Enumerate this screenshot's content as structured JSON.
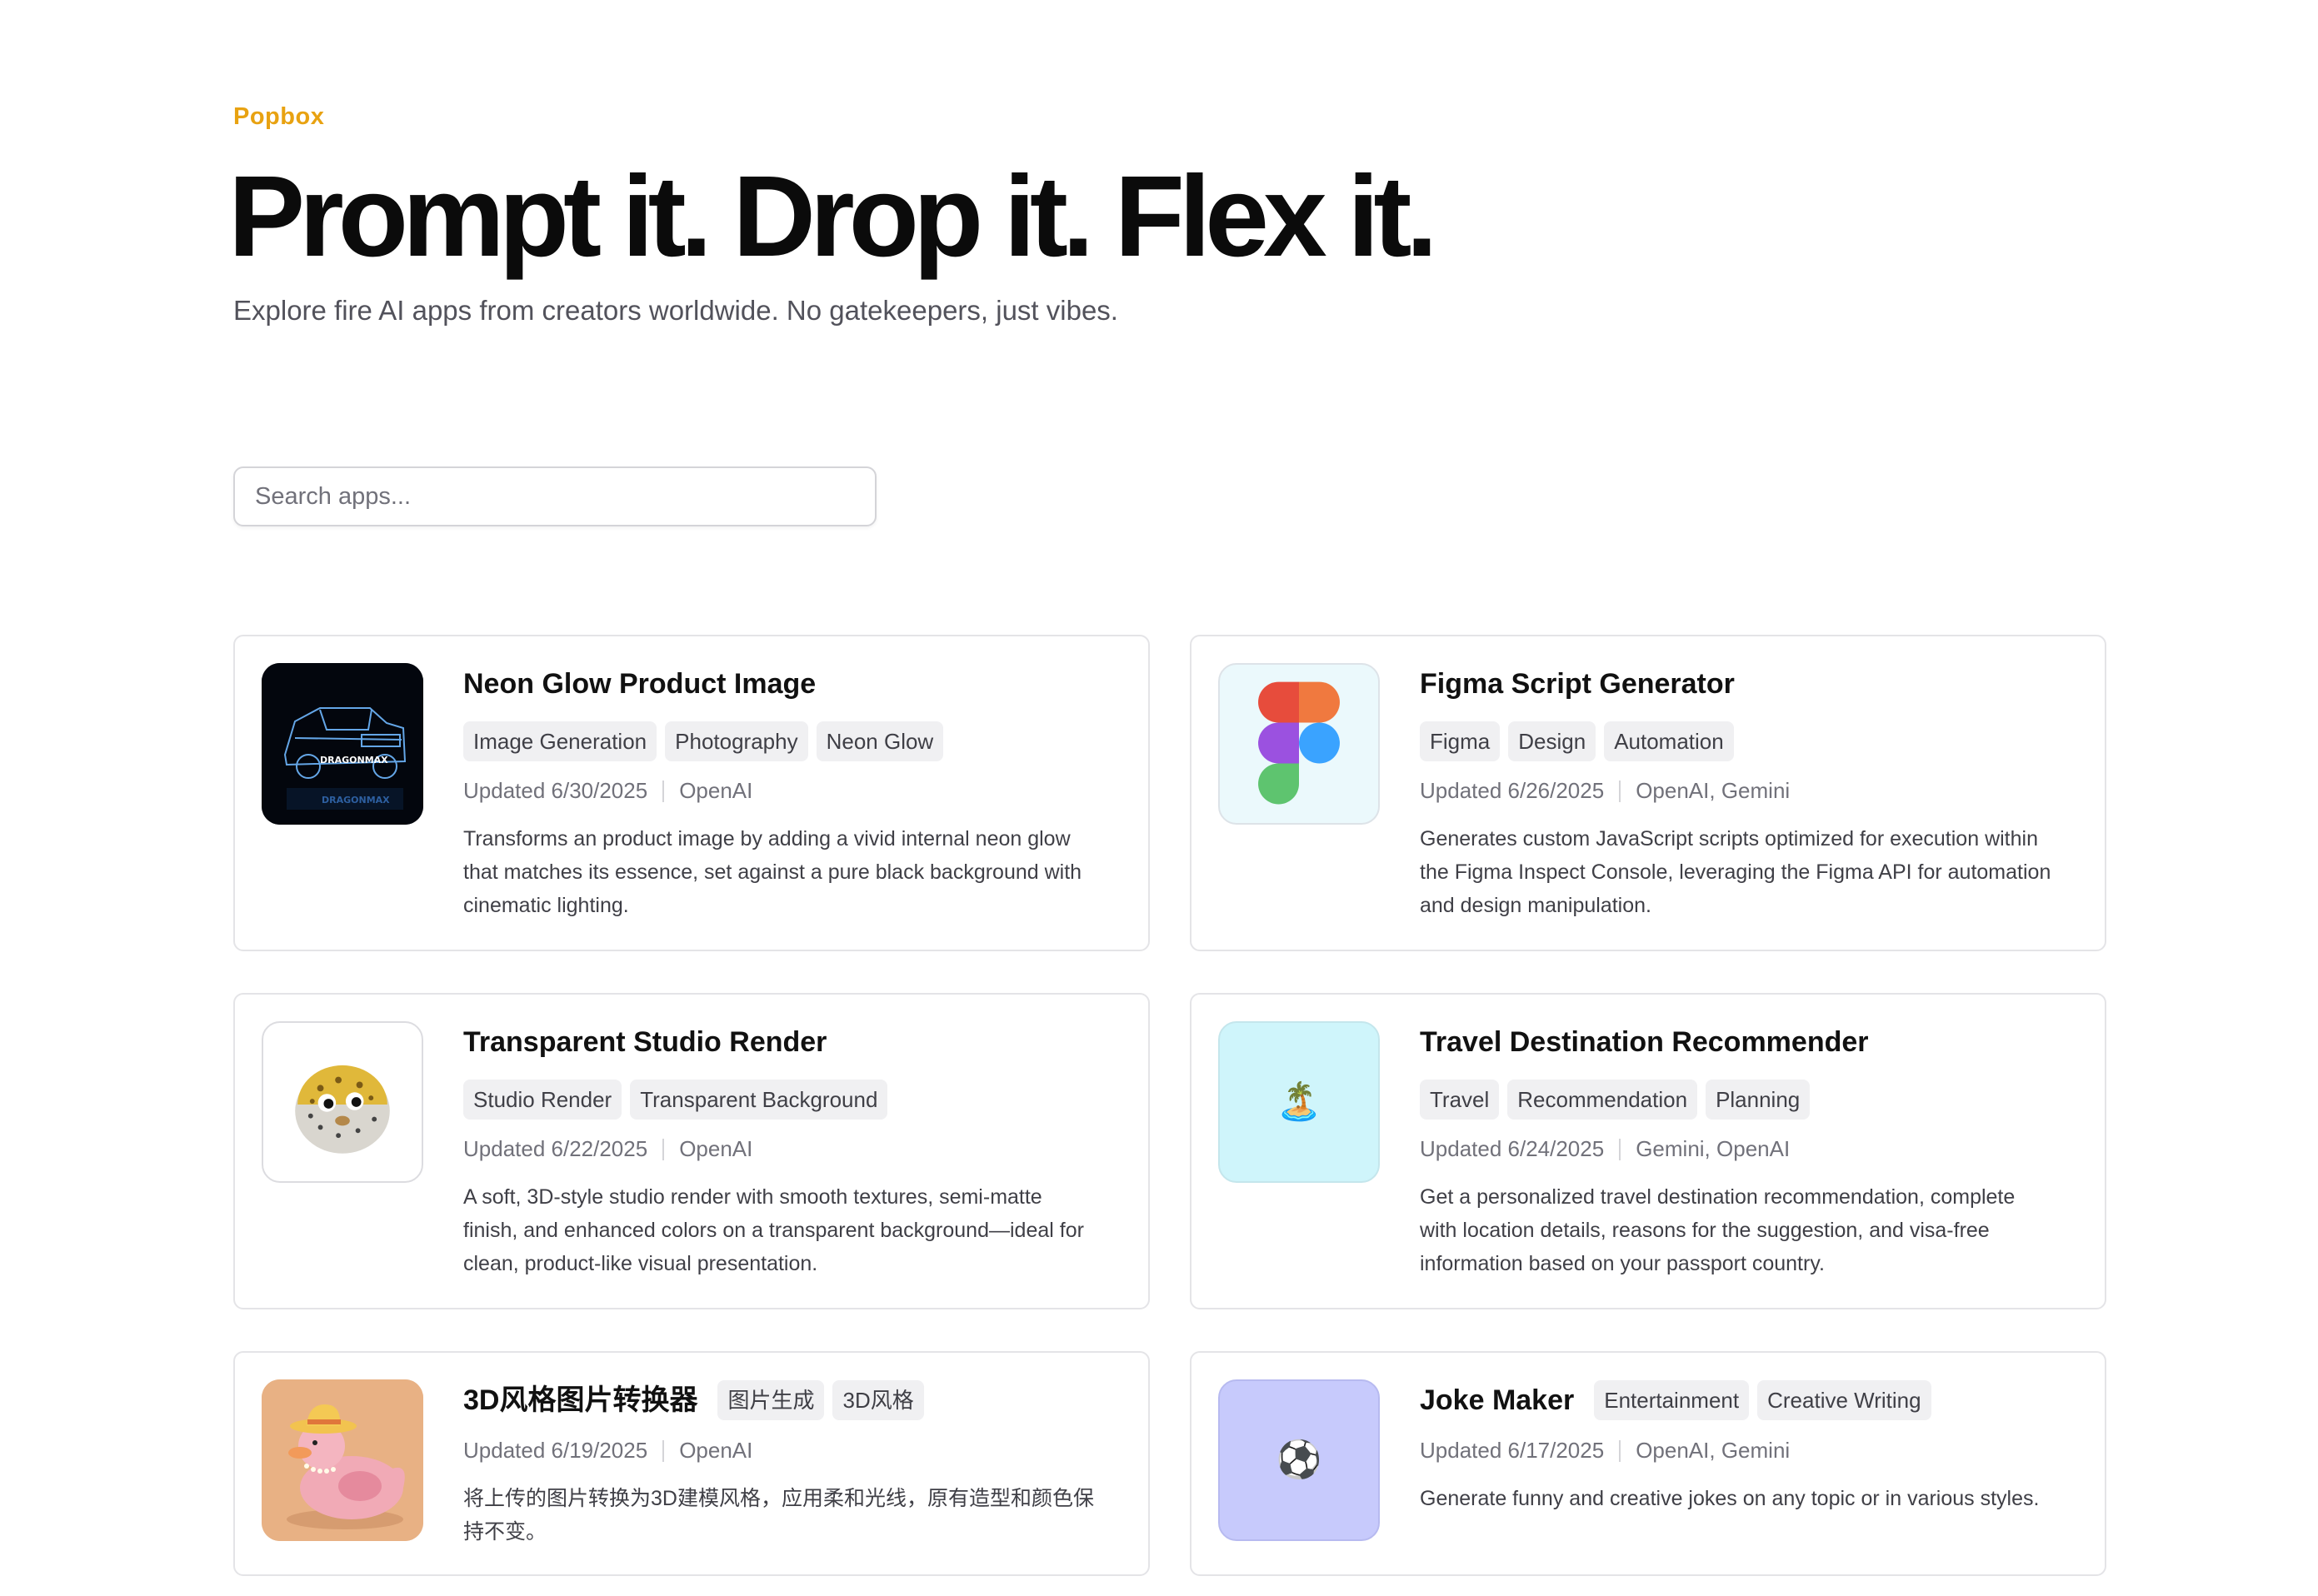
{
  "header": {
    "brand": "Popbox",
    "headline": "Prompt it. Drop it. Flex it.",
    "subheadline": "Explore fire AI apps from creators worldwide. No gatekeepers, just vibes."
  },
  "search": {
    "placeholder": "Search apps..."
  },
  "apps": [
    {
      "title": "Neon Glow Product Image",
      "tags": [
        "Image Generation",
        "Photography",
        "Neon Glow"
      ],
      "updated": "Updated 6/30/2025",
      "models": "OpenAI",
      "description": "Transforms an product image by adding a vivid internal neon glow that matches its essence, set against a pure black background with cinematic lighting.",
      "icon": "neon-truck-image",
      "icon_text": "DRAGONMAX"
    },
    {
      "title": "Figma Script Generator",
      "tags": [
        "Figma",
        "Design",
        "Automation"
      ],
      "updated": "Updated 6/26/2025",
      "models": "OpenAI, Gemini",
      "description": "Generates custom JavaScript scripts optimized for execution within the Figma Inspect Console, leveraging the Figma API for automation and design manipulation.",
      "icon": "figma-logo"
    },
    {
      "title": "Transparent Studio Render",
      "tags": [
        "Studio Render",
        "Transparent Background"
      ],
      "updated": "Updated 6/22/2025",
      "models": "OpenAI",
      "description": "A soft, 3D-style studio render with smooth textures, semi-matte finish, and enhanced colors on a transparent background—ideal for clean, product-like visual presentation.",
      "icon": "pufferfish-image"
    },
    {
      "title": "Travel Destination Recommender",
      "tags": [
        "Travel",
        "Recommendation",
        "Planning"
      ],
      "updated": "Updated 6/24/2025",
      "models": "Gemini, OpenAI",
      "description": "Get a personalized travel destination recommendation, complete with location details, reasons for the suggestion, and visa-free information based on your passport country.",
      "icon": "desert-island-emoji",
      "icon_glyph": "🏝️"
    },
    {
      "title": "3D风格图片转换器",
      "tags": [
        "图片生成",
        "3D风格"
      ],
      "updated": "Updated 6/19/2025",
      "models": "OpenAI",
      "description": "将上传的图片转换为3D建模风格，应用柔和光线，原有造型和颜色保持不变。",
      "icon": "pink-duck-image"
    },
    {
      "title": "Joke Maker",
      "tags": [
        "Entertainment",
        "Creative Writing"
      ],
      "updated": "Updated 6/17/2025",
      "models": "OpenAI, Gemini",
      "description": "Generate funny and creative jokes on any topic or in various styles.",
      "icon": "soccer-ball-emoji",
      "icon_glyph": "⚽"
    }
  ],
  "colors": {
    "brand": "#e8a211",
    "headline": "#0b0b0b",
    "tag_bg": "#f0f0f2",
    "card_border": "#e4e4e7",
    "travel_icon_bg": "#cff5fb",
    "joke_icon_bg": "#c7cafc",
    "figma_icon_bg": "#ebf9fc"
  }
}
